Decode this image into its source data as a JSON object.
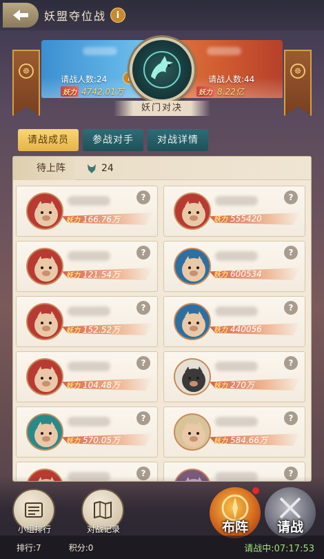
{
  "header": {
    "title": "妖盟夺位战",
    "info_icon": "i",
    "back_icon": "back-arrow-icon"
  },
  "versus": {
    "left": {
      "challenge_label": "请战人数:24",
      "power_label": "妖力",
      "power_value": "4742.01万",
      "info_icon": "i"
    },
    "right": {
      "challenge_label": "请战人数:44",
      "power_label": "妖力",
      "power_value": "8.22亿"
    },
    "subtitle": "妖门对决"
  },
  "tabs": [
    {
      "label": "请战成员",
      "active": true
    },
    {
      "label": "参战对手",
      "active": false
    },
    {
      "label": "对战详情",
      "active": false
    }
  ],
  "panel": {
    "status": "待上阵",
    "count": "24"
  },
  "members": [
    {
      "power_label": "妖力",
      "power": "166.76万",
      "avatar": "boar-red"
    },
    {
      "power_label": "妖力",
      "power": "555420",
      "avatar": "boar-red"
    },
    {
      "power_label": "妖力",
      "power": "121.54万",
      "avatar": "boar-red"
    },
    {
      "power_label": "妖力",
      "power": "600534",
      "avatar": "boar-blue"
    },
    {
      "power_label": "妖力",
      "power": "152.52万",
      "avatar": "boar-red"
    },
    {
      "power_label": "妖力",
      "power": "440056",
      "avatar": "boar-blue"
    },
    {
      "power_label": "妖力",
      "power": "104.48万",
      "avatar": "boar-red"
    },
    {
      "power_label": "妖力",
      "power": "270万",
      "avatar": "eagle"
    },
    {
      "power_label": "妖力",
      "power": "570.05万",
      "avatar": "boar-teal"
    },
    {
      "power_label": "妖力",
      "power": "584.66万",
      "avatar": "boar-cream"
    },
    {
      "power_label": "妖力",
      "power": "",
      "avatar": "boar-red"
    },
    {
      "power_label": "妖力",
      "power": "",
      "avatar": "monster"
    }
  ],
  "help_icon": "?",
  "bottom": {
    "group_rank_label": "小组排行",
    "battle_record_label": "对战记录",
    "formation_label": "布阵",
    "challenge_label": "请战",
    "rank_text": "排行:7",
    "score_text": "积分:0",
    "war_status": "请战中:07:17:53"
  },
  "colors": {
    "blue_side": "#5fb2e6",
    "red_side": "#d15c30",
    "active_tab": "#e7b445",
    "inactive_tab": "#1f5058",
    "status_green": "#9ee07a"
  }
}
